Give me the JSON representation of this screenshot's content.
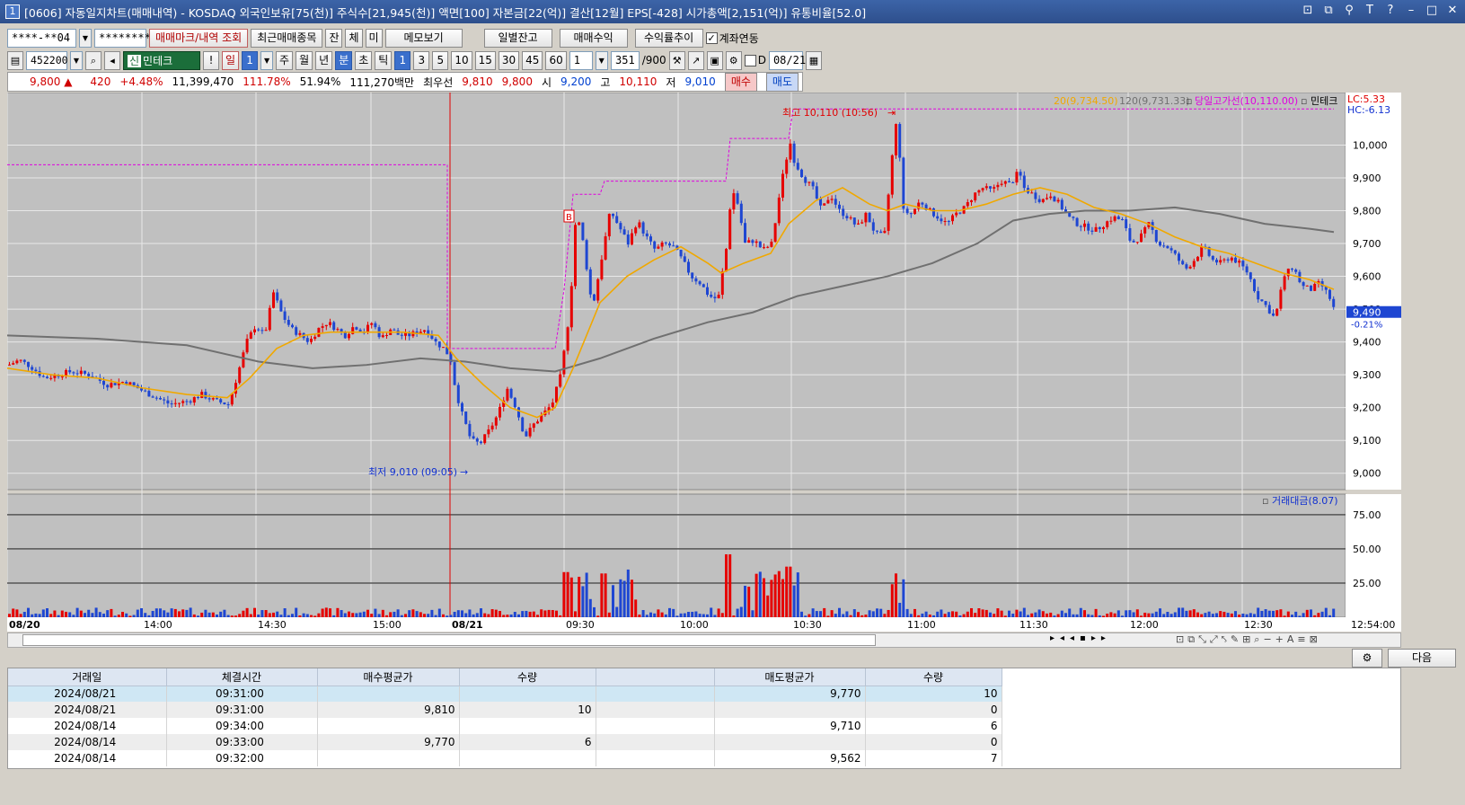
{
  "window": {
    "title": "[0606] 자동일지차트(매매내역) - KOSDAQ 외국인보유[75(천)] 주식수[21,945(천)] 액면[100] 자본금[22(억)] 결산[12월] EPS[-428] 시가총액[2,151(억)] 유통비율[52.0]",
    "icon_text": "1"
  },
  "toolbar1": {
    "account_value": "****-**04",
    "password_value": "*********",
    "btn_trade_marks": "매매마크/내역 조회",
    "btn_recent": "최근매매종목",
    "btn_jan": "잔",
    "btn_che": "체",
    "btn_mi": "미",
    "btn_memo": "메모보기",
    "btn_daily_balance": "일별잔고",
    "btn_trade_profit": "매매수익",
    "btn_return_trend": "수익률추이",
    "account_link_label": "계좌연동",
    "account_link_checked": "✓"
  },
  "toolbar2": {
    "code": "452200",
    "sin": "신",
    "name": "민테크",
    "periods": [
      "일",
      "1",
      "주",
      "월",
      "년",
      "분",
      "초",
      "틱",
      "1",
      "3",
      "5",
      "10",
      "15",
      "30",
      "45",
      "60",
      "1"
    ],
    "count_value": "351",
    "count_total": "/900",
    "d_label": "D",
    "date_value": "08/21"
  },
  "quote": {
    "price": "9,800",
    "change_arrow": "▲",
    "change": "420",
    "change_pct": "+4.48%",
    "volume": "11,399,470",
    "volume_ratio": "111.78%",
    "turnover": "51.94%",
    "amount": "111,270백만",
    "best_label": "최우선",
    "best_ask": "9,810",
    "best_bid": "9,800",
    "open_label": "시",
    "open": "9,200",
    "high_label": "고",
    "high": "10,110",
    "low_label": "저",
    "low": "9,010",
    "buy_btn": "매수",
    "sell_btn": "매도"
  },
  "chart_data": {
    "type": "candlestick",
    "legend": {
      "ma20": "20(9,734.50)",
      "ma120": "120(9,731.33)",
      "day_high_line": "당일고가선(10,110.00)",
      "stock": "민테크",
      "lc": "LC:5.33",
      "hc": "HC:-6.13"
    },
    "colors": {
      "up": "#e60000",
      "down": "#1e46d2",
      "ma20": "#f0a800",
      "ma120": "#707070",
      "dayhigh": "#e000e0"
    },
    "price_ticks": [
      "10,000",
      "9,900",
      "9,800",
      "9,700",
      "9,600",
      "9,500",
      "9,400",
      "9,300",
      "9,200",
      "9,100",
      "9,000"
    ],
    "price_range": [
      8950,
      10160
    ],
    "current_price": "9,490",
    "current_pct": "-0.21%",
    "high_annotation": "최고 10,110 (10:56)",
    "low_annotation": "최저 9,010 (09:05)",
    "marker_b": "B",
    "volume_title": "거래대금(8.07)",
    "volume_ticks": [
      "75.00",
      "50.00",
      "25.00"
    ],
    "volume_range": [
      0,
      90
    ],
    "time_labels": [
      "08/20",
      "14:00",
      "14:30",
      "15:00",
      "08/21",
      "09:30",
      "10:00",
      "10:30",
      "11:00",
      "11:30",
      "12:00",
      "12:30"
    ],
    "last_time": "12:54:00",
    "price_path": [
      [
        0,
        9330
      ],
      [
        12,
        9345
      ],
      [
        25,
        9325
      ],
      [
        40,
        9290
      ],
      [
        55,
        9300
      ],
      [
        70,
        9310
      ],
      [
        90,
        9300
      ],
      [
        110,
        9270
      ],
      [
        130,
        9280
      ],
      [
        150,
        9250
      ],
      [
        165,
        9230
      ],
      [
        180,
        9210
      ],
      [
        200,
        9220
      ],
      [
        215,
        9240
      ],
      [
        230,
        9220
      ],
      [
        245,
        9210
      ],
      [
        255,
        9300
      ],
      [
        265,
        9400
      ],
      [
        275,
        9450
      ],
      [
        285,
        9420
      ],
      [
        295,
        9550
      ],
      [
        305,
        9480
      ],
      [
        315,
        9440
      ],
      [
        325,
        9420
      ],
      [
        335,
        9400
      ],
      [
        345,
        9440
      ],
      [
        355,
        9460
      ],
      [
        365,
        9440
      ],
      [
        375,
        9420
      ],
      [
        385,
        9450
      ],
      [
        395,
        9430
      ],
      [
        405,
        9460
      ],
      [
        415,
        9410
      ],
      [
        425,
        9440
      ],
      [
        435,
        9420
      ],
      [
        445,
        9420
      ],
      [
        455,
        9430
      ],
      [
        465,
        9440
      ],
      [
        475,
        9400
      ],
      [
        485,
        9380
      ],
      [
        492,
        9350
      ],
      [
        498,
        9250
      ],
      [
        505,
        9180
      ],
      [
        515,
        9100
      ],
      [
        525,
        9090
      ],
      [
        535,
        9130
      ],
      [
        545,
        9180
      ],
      [
        555,
        9260
      ],
      [
        565,
        9200
      ],
      [
        575,
        9110
      ],
      [
        585,
        9150
      ],
      [
        595,
        9180
      ],
      [
        605,
        9210
      ],
      [
        615,
        9300
      ],
      [
        625,
        9500
      ],
      [
        632,
        9800
      ],
      [
        640,
        9700
      ],
      [
        650,
        9500
      ],
      [
        660,
        9650
      ],
      [
        670,
        9800
      ],
      [
        680,
        9750
      ],
      [
        690,
        9700
      ],
      [
        700,
        9770
      ],
      [
        710,
        9720
      ],
      [
        720,
        9680
      ],
      [
        730,
        9700
      ],
      [
        740,
        9690
      ],
      [
        750,
        9650
      ],
      [
        760,
        9600
      ],
      [
        770,
        9580
      ],
      [
        780,
        9540
      ],
      [
        790,
        9530
      ],
      [
        800,
        9700
      ],
      [
        805,
        9870
      ],
      [
        812,
        9820
      ],
      [
        820,
        9700
      ],
      [
        830,
        9710
      ],
      [
        840,
        9680
      ],
      [
        850,
        9700
      ],
      [
        860,
        9880
      ],
      [
        870,
        10010
      ],
      [
        875,
        9950
      ],
      [
        885,
        9900
      ],
      [
        895,
        9870
      ],
      [
        905,
        9800
      ],
      [
        915,
        9850
      ],
      [
        925,
        9800
      ],
      [
        935,
        9780
      ],
      [
        945,
        9750
      ],
      [
        955,
        9790
      ],
      [
        965,
        9730
      ],
      [
        975,
        9720
      ],
      [
        985,
        10000
      ],
      [
        990,
        10100
      ],
      [
        995,
        9800
      ],
      [
        1005,
        9790
      ],
      [
        1015,
        9830
      ],
      [
        1025,
        9800
      ],
      [
        1035,
        9780
      ],
      [
        1045,
        9760
      ],
      [
        1055,
        9790
      ],
      [
        1065,
        9810
      ],
      [
        1075,
        9850
      ],
      [
        1085,
        9870
      ],
      [
        1095,
        9860
      ],
      [
        1105,
        9890
      ],
      [
        1115,
        9880
      ],
      [
        1125,
        9920
      ],
      [
        1130,
        9870
      ],
      [
        1140,
        9850
      ],
      [
        1150,
        9830
      ],
      [
        1160,
        9850
      ],
      [
        1170,
        9820
      ],
      [
        1180,
        9780
      ],
      [
        1190,
        9760
      ],
      [
        1200,
        9750
      ],
      [
        1210,
        9740
      ],
      [
        1220,
        9760
      ],
      [
        1230,
        9780
      ],
      [
        1240,
        9770
      ],
      [
        1250,
        9700
      ],
      [
        1260,
        9720
      ],
      [
        1270,
        9760
      ],
      [
        1280,
        9700
      ],
      [
        1290,
        9690
      ],
      [
        1300,
        9660
      ],
      [
        1310,
        9620
      ],
      [
        1320,
        9650
      ],
      [
        1330,
        9690
      ],
      [
        1340,
        9650
      ],
      [
        1350,
        9640
      ],
      [
        1360,
        9660
      ],
      [
        1370,
        9640
      ],
      [
        1380,
        9610
      ],
      [
        1390,
        9540
      ],
      [
        1400,
        9510
      ],
      [
        1410,
        9470
      ],
      [
        1420,
        9600
      ],
      [
        1430,
        9630
      ],
      [
        1440,
        9570
      ],
      [
        1450,
        9560
      ],
      [
        1460,
        9580
      ],
      [
        1470,
        9540
      ],
      [
        1477,
        9490
      ]
    ],
    "ma20_path": [
      [
        0,
        9320
      ],
      [
        50,
        9300
      ],
      [
        100,
        9290
      ],
      [
        150,
        9260
      ],
      [
        200,
        9240
      ],
      [
        245,
        9230
      ],
      [
        270,
        9290
      ],
      [
        300,
        9380
      ],
      [
        330,
        9420
      ],
      [
        360,
        9430
      ],
      [
        400,
        9430
      ],
      [
        440,
        9430
      ],
      [
        480,
        9420
      ],
      [
        500,
        9350
      ],
      [
        530,
        9270
      ],
      [
        560,
        9200
      ],
      [
        590,
        9170
      ],
      [
        610,
        9200
      ],
      [
        630,
        9320
      ],
      [
        660,
        9520
      ],
      [
        690,
        9600
      ],
      [
        720,
        9650
      ],
      [
        750,
        9690
      ],
      [
        780,
        9640
      ],
      [
        795,
        9610
      ],
      [
        820,
        9640
      ],
      [
        850,
        9670
      ],
      [
        870,
        9760
      ],
      [
        900,
        9830
      ],
      [
        930,
        9870
      ],
      [
        960,
        9820
      ],
      [
        980,
        9800
      ],
      [
        1000,
        9820
      ],
      [
        1030,
        9800
      ],
      [
        1060,
        9800
      ],
      [
        1090,
        9820
      ],
      [
        1120,
        9850
      ],
      [
        1150,
        9870
      ],
      [
        1180,
        9850
      ],
      [
        1210,
        9810
      ],
      [
        1240,
        9790
      ],
      [
        1270,
        9760
      ],
      [
        1300,
        9720
      ],
      [
        1330,
        9690
      ],
      [
        1360,
        9670
      ],
      [
        1390,
        9640
      ],
      [
        1420,
        9610
      ],
      [
        1450,
        9590
      ],
      [
        1477,
        9560
      ]
    ],
    "ma120_path": [
      [
        0,
        9420
      ],
      [
        100,
        9410
      ],
      [
        200,
        9390
      ],
      [
        280,
        9340
      ],
      [
        340,
        9320
      ],
      [
        400,
        9330
      ],
      [
        460,
        9350
      ],
      [
        510,
        9340
      ],
      [
        560,
        9320
      ],
      [
        610,
        9310
      ],
      [
        660,
        9350
      ],
      [
        720,
        9410
      ],
      [
        780,
        9460
      ],
      [
        830,
        9490
      ],
      [
        880,
        9540
      ],
      [
        930,
        9570
      ],
      [
        980,
        9600
      ],
      [
        1030,
        9640
      ],
      [
        1080,
        9700
      ],
      [
        1120,
        9770
      ],
      [
        1160,
        9790
      ],
      [
        1200,
        9800
      ],
      [
        1250,
        9800
      ],
      [
        1300,
        9810
      ],
      [
        1350,
        9790
      ],
      [
        1400,
        9760
      ],
      [
        1450,
        9745
      ],
      [
        1477,
        9735
      ]
    ],
    "dayhigh_path": [
      [
        0,
        9940
      ],
      [
        490,
        9940
      ],
      [
        490,
        9380
      ],
      [
        610,
        9380
      ],
      [
        620,
        9560
      ],
      [
        630,
        9850
      ],
      [
        660,
        9850
      ],
      [
        665,
        9890
      ],
      [
        800,
        9890
      ],
      [
        805,
        10020
      ],
      [
        870,
        10020
      ],
      [
        875,
        10110
      ],
      [
        1477,
        10110
      ]
    ]
  },
  "grid_controls": {
    "next_btn": "다음"
  },
  "trades_table": {
    "headers": [
      "거래일",
      "체결시간",
      "매수평균가",
      "수량",
      "",
      "매도평균가",
      "수량"
    ],
    "rows": [
      [
        "2024/08/21",
        "09:31:00",
        "",
        "",
        "",
        "9,770",
        "10"
      ],
      [
        "2024/08/21",
        "09:31:00",
        "9,810",
        "10",
        "",
        "",
        "0"
      ],
      [
        "2024/08/14",
        "09:34:00",
        "",
        "",
        "",
        "9,710",
        "6"
      ],
      [
        "2024/08/14",
        "09:33:00",
        "9,770",
        "6",
        "",
        "",
        "0"
      ],
      [
        "2024/08/14",
        "09:32:00",
        "",
        "",
        "",
        "9,562",
        "7"
      ]
    ]
  }
}
